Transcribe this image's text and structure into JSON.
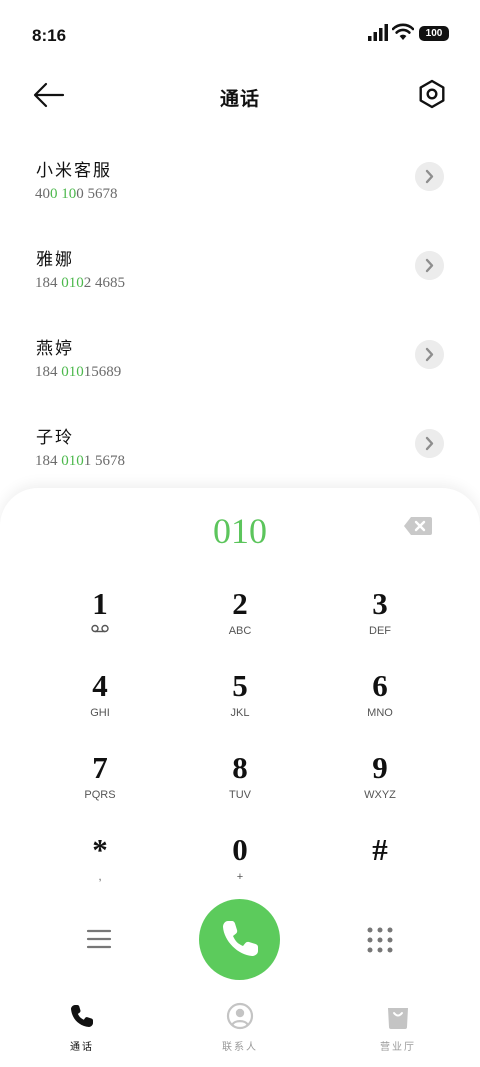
{
  "status_bar": {
    "time": "8:16",
    "battery": "100"
  },
  "header": {
    "title": "通话"
  },
  "contacts": [
    {
      "name": "小米客服",
      "number_parts": [
        "40",
        "0 10",
        "0 5678"
      ]
    },
    {
      "name": "雅娜",
      "number_parts": [
        "184 ",
        "010",
        "2 4685"
      ]
    },
    {
      "name": "燕婷",
      "number_parts": [
        "184 ",
        "010",
        "15689"
      ]
    },
    {
      "name": "子玲",
      "number_parts": [
        "184 ",
        "010",
        "1 5678"
      ]
    }
  ],
  "dialer": {
    "value": "010",
    "keys": [
      {
        "digit": "1",
        "letters": ""
      },
      {
        "digit": "2",
        "letters": "ABC"
      },
      {
        "digit": "3",
        "letters": "DEF"
      },
      {
        "digit": "4",
        "letters": "GHI"
      },
      {
        "digit": "5",
        "letters": "JKL"
      },
      {
        "digit": "6",
        "letters": "MNO"
      },
      {
        "digit": "7",
        "letters": "PQRS"
      },
      {
        "digit": "8",
        "letters": "TUV"
      },
      {
        "digit": "9",
        "letters": "WXYZ"
      },
      {
        "digit": "*",
        "letters": ","
      },
      {
        "digit": "0",
        "letters": "+"
      },
      {
        "digit": "#",
        "letters": ""
      }
    ]
  },
  "nav": {
    "tabs": [
      {
        "label": "通话",
        "icon": "phone-icon",
        "active": true
      },
      {
        "label": "联系人",
        "icon": "person-icon",
        "active": false
      },
      {
        "label": "营业厅",
        "icon": "shopping-bag-icon",
        "active": false
      }
    ]
  },
  "colors": {
    "accent": "#5ccb5c",
    "highlight": "#4cb84c",
    "inactive": "#c4c4c4"
  }
}
